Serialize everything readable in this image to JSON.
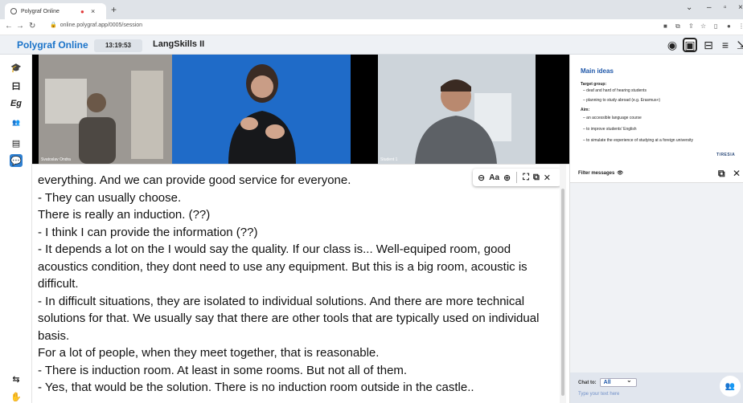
{
  "browser": {
    "tab_title": "Polygraf Online",
    "recording_dot": "●",
    "close_x": "×",
    "new_tab": "+",
    "url": "online.polygraf.app/0005/session"
  },
  "app": {
    "brand": "Polygraf Online",
    "clock": "13:19:53",
    "session_name": "LangSkills II"
  },
  "videos": [
    {
      "label": "Svatoslav Ondra"
    },
    {
      "label": ""
    },
    {
      "label": "Student 1"
    }
  ],
  "slide": {
    "title": "Main ideas",
    "lines": [
      {
        "text": "Target group:",
        "bold": true
      },
      {
        "text": "– deaf and hard of hearing students",
        "bold": false
      },
      {
        "text": "– planning to study abroad (e.g. Erasmus+)",
        "bold": false
      },
      {
        "text": "Aim:",
        "bold": true
      },
      {
        "text": "– an accessible language course",
        "bold": false
      },
      {
        "text": "– to improve students' English",
        "bold": false
      },
      {
        "text": "– to simulate the experience of studying at a foreign university",
        "bold": false
      }
    ],
    "logo_text": "TIRESIA"
  },
  "transcript": {
    "lines": [
      "everything. And we can provide good service for everyone.",
      "- They can usually choose.",
      "There is really an induction. (??)",
      "- I think I can provide the information (??)",
      "- It depends a lot on the I would say the quality. If our class is... Well-equiped room, good acoustics condition, they dont need to use any equipment. But this is a big room, acoustic is difficult.",
      "- In difficult situations, they are isolated to individual solutions. And there are more technical solutions for that. We usually say that there are other tools that are typically used on individual basis.",
      "For a lot of people, when they meet together, that is reasonable.",
      "- There is induction room. At least in some rooms. But not all of them.",
      "- Yes, that would be the solution. There is no induction room outside in the castle.."
    ],
    "tools": {
      "zoom_out": "⊖",
      "font": "Aa",
      "zoom_in": "⊕"
    }
  },
  "chat": {
    "filter_label": "Filter messages",
    "chat_to_label": "Chat to:",
    "chat_to_value": "All",
    "input_placeholder": "Type your text here"
  }
}
